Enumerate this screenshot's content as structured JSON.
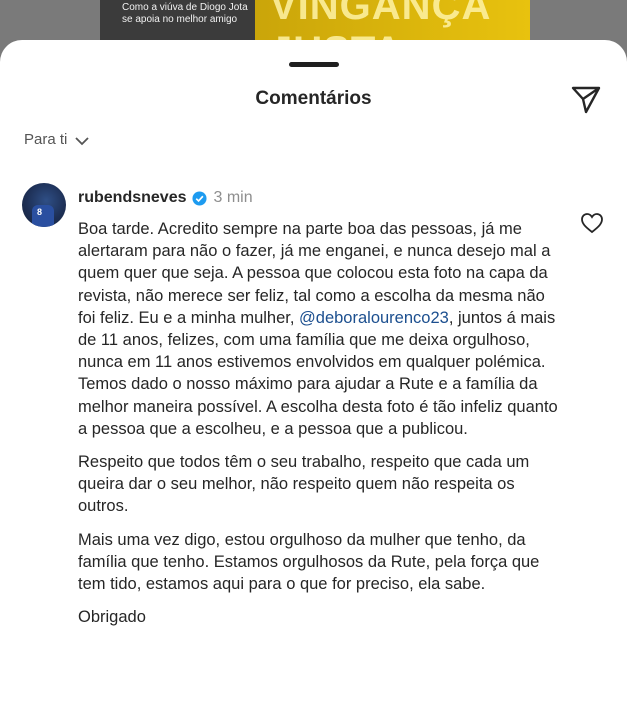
{
  "backdrop": {
    "caption": "Como a viúva de Diogo Jota se apoia no melhor amigo",
    "headline": "VINGANÇA JUSTA"
  },
  "sheet": {
    "title": "Comentários",
    "filter_label": "Para ti"
  },
  "comment": {
    "username": "rubendsneves",
    "time": "3 min",
    "p1_a": "Boa tarde. Acredito sempre na parte boa das pessoas, já me alertaram para não o fazer, já me enganei, e nunca desejo mal a quem quer que seja. A pessoa que colocou esta foto na capa da revista, não merece ser feliz, tal como a escolha da mesma não foi feliz. Eu e a minha mulher, ",
    "mention": "@deboralourenco23",
    "p1_b": ", juntos á mais de 11 anos, felizes, com uma família que me deixa orgulhoso, nunca em 11 anos estivemos envolvidos em qualquer polémica. Temos dado o nosso máximo para ajudar a Rute e a família da melhor maneira possível. A escolha desta foto é tão infeliz quanto a pessoa que a escolheu, e a pessoa que a publicou.",
    "p2": "Respeito que todos têm o seu trabalho, respeito que cada um queira dar o seu melhor, não respeito quem não respeita os outros.",
    "p3": "Mais uma vez digo, estou orgulhoso da mulher que tenho, da família que tenho. Estamos orgulhosos da Rute, pela força que tem tido, estamos aqui para o que for preciso, ela sabe.",
    "p4": "Obrigado"
  },
  "icons": {
    "share": "send-icon",
    "verified": "verified-badge-icon",
    "like": "heart-icon",
    "filter_chevron": "chevron-down-icon"
  },
  "colors": {
    "mention": "#1c4f8f",
    "verified": "#1d9bf0",
    "secondary_text": "#8e8e8e"
  }
}
